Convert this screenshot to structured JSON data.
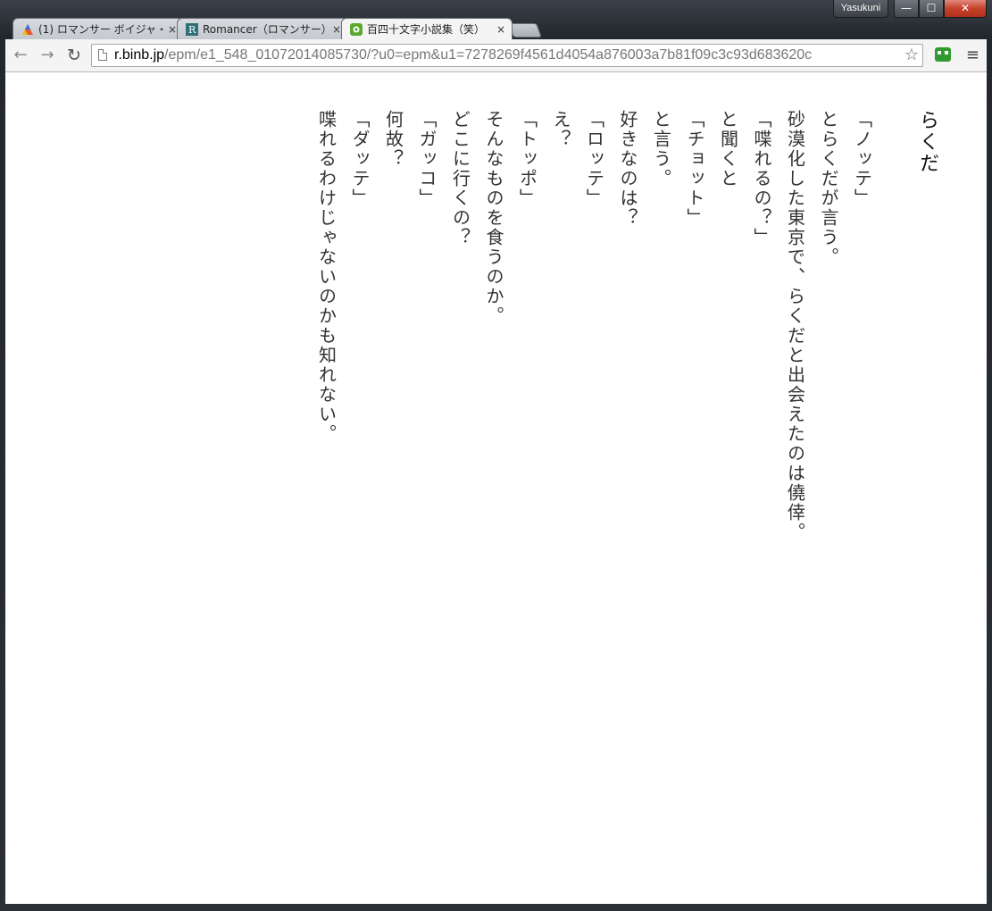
{
  "window": {
    "profile_name": "Yasukuni",
    "minimize": "—",
    "maximize": "☐",
    "close": "✕"
  },
  "tabs": [
    {
      "title": "(1) ロマンサー ボイジャ・",
      "icon": "romancer-triangle-icon",
      "active": false
    },
    {
      "title": "Romancer（ロマンサー）",
      "icon": "romancer-r-icon",
      "active": false
    },
    {
      "title": "百四十文字小説集（笑）",
      "icon": "binb-reader-icon",
      "active": true
    }
  ],
  "tab_close": "×",
  "toolbar": {
    "back": "←",
    "forward": "→",
    "reload": "↻",
    "url_host": "r.binb.jp",
    "url_path": "/epm/e1_548_01072014085730/?u0=epm&u1=7278269f4561d4054a876003a7b81f09c3c93d683620c",
    "star": "☆",
    "menu": "≡"
  },
  "story": {
    "title": "らくだ",
    "lines": [
      "「ノッテ」",
      "とらくだが言う。",
      "砂漠化した東京で、らくだと出会えたのは僥倖。",
      "「喋れるの？」",
      "と聞くと",
      "「チョット」",
      "と言う。",
      "好きなのは？",
      "「ロッテ」",
      "え？",
      "「トッポ」",
      "そんなものを食うのか。",
      "どこに行くの？",
      "「ガッコ」",
      "何故？",
      "「ダッテ」",
      "喋れるわけじゃないのかも知れない。"
    ]
  },
  "colors": {
    "frame": "#2a2f35",
    "toolbar": "#f4f4f4",
    "close_button": "#c6412c",
    "extension": "#2f9a2f"
  }
}
